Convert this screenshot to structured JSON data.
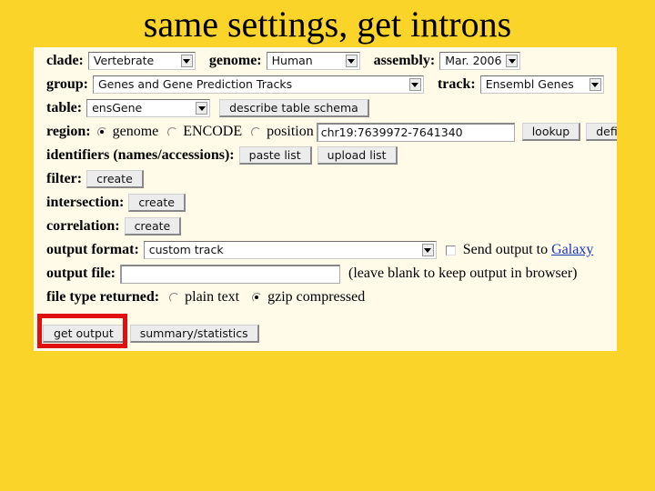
{
  "slide": {
    "title": "same settings, get introns"
  },
  "form": {
    "clade": {
      "label": "clade:",
      "value": "Vertebrate"
    },
    "genome": {
      "label": "genome:",
      "value": "Human"
    },
    "assembly": {
      "label": "assembly:",
      "value": "Mar. 2006"
    },
    "group": {
      "label": "group:",
      "value": "Genes and Gene Prediction Tracks"
    },
    "track": {
      "label": "track:",
      "value": "Ensembl Genes"
    },
    "table": {
      "label": "table:",
      "value": "ensGene",
      "describe_button": "describe table schema"
    },
    "region": {
      "label": "region:",
      "options": [
        {
          "label": "genome",
          "selected": true
        },
        {
          "label": "ENCODE",
          "selected": false
        },
        {
          "label": "position",
          "selected": false
        }
      ],
      "position_value": "chr19:7639972-7641340",
      "lookup_button": "lookup",
      "define_button": "define regions"
    },
    "identifiers": {
      "label": "identifiers (names/accessions):",
      "paste_button": "paste list",
      "upload_button": "upload list"
    },
    "filter": {
      "label": "filter:",
      "button": "create"
    },
    "intersection": {
      "label": "intersection:",
      "button": "create"
    },
    "correlation": {
      "label": "correlation:",
      "button": "create"
    },
    "output_format": {
      "label": "output format:",
      "value": "custom track",
      "send_checked": false,
      "send_text": "Send output to",
      "send_link": "Galaxy"
    },
    "output_file": {
      "label": "output file:",
      "value": "",
      "hint": "(leave blank to keep output in browser)"
    },
    "file_type": {
      "label": "file type returned:",
      "options": [
        {
          "label": "plain text",
          "selected": false
        },
        {
          "label": "gzip compressed",
          "selected": true
        }
      ]
    },
    "actions": {
      "get_output": "get output",
      "summary": "summary/statistics"
    }
  },
  "colors": {
    "background": "#fbd42a",
    "panel": "#fffbe8",
    "highlight": "#e01010",
    "link": "#1a33b5"
  }
}
